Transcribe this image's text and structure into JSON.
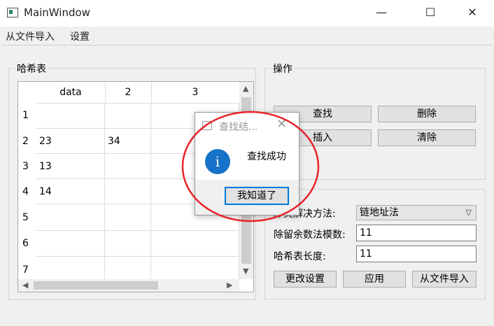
{
  "window": {
    "title": "MainWindow",
    "minimize": "—",
    "maximize": "☐",
    "close": "✕"
  },
  "menu": {
    "import": "从文件导入",
    "settings": "设置"
  },
  "hash_group": {
    "title": "哈希表"
  },
  "table": {
    "columns": [
      "data",
      "2",
      "3"
    ],
    "rows": [
      {
        "num": "1",
        "cells": [
          "",
          "",
          ""
        ]
      },
      {
        "num": "2",
        "cells": [
          "23",
          "34",
          ""
        ]
      },
      {
        "num": "3",
        "cells": [
          "13",
          "",
          ""
        ]
      },
      {
        "num": "4",
        "cells": [
          "14",
          "",
          ""
        ]
      },
      {
        "num": "5",
        "cells": [
          "",
          "",
          ""
        ]
      },
      {
        "num": "6",
        "cells": [
          "",
          "",
          ""
        ]
      },
      {
        "num": "7",
        "cells": [
          "",
          "",
          ""
        ]
      }
    ]
  },
  "ops_group": {
    "title": "操作",
    "find": "查找",
    "delete": "删除",
    "insert": "插入",
    "clear": "清除"
  },
  "settings_group": {
    "collision_label": "冲突解决方法:",
    "collision_value": "链地址法",
    "mod_label": "除留余数法模数:",
    "mod_value": "11",
    "length_label": "哈希表长度:",
    "length_value": "11",
    "change_btn": "更改设置",
    "apply_btn": "应用",
    "import_btn": "从文件导入"
  },
  "dialog": {
    "title": "查找结...",
    "message": "查找成功",
    "ok": "我知道了",
    "icon": "i"
  },
  "colors": {
    "annotation": "#e8242b",
    "info": "#1672c8",
    "focus": "#0078d7"
  }
}
